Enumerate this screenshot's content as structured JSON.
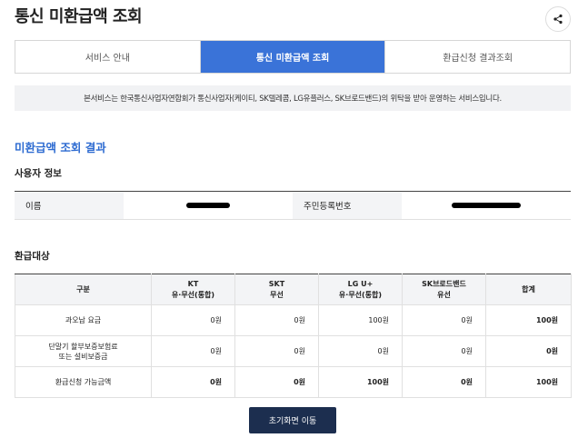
{
  "page": {
    "title": "통신 미환급액 조회",
    "share_icon": "share-icon"
  },
  "tabs": [
    {
      "label": "서비스 안내",
      "active": false
    },
    {
      "label": "통신 미환급액 조회",
      "active": true
    },
    {
      "label": "환급신청 결과조회",
      "active": false
    }
  ],
  "notice": "본서비스는 한국통신사업자연합회가 통신사업자(케이티, SK텔레콤, LG유플러스, SK브로드밴드)의 위탁을 받아 운영하는 서비스입니다.",
  "result_title": "미환급액 조회 결과",
  "user_info": {
    "title": "사용자 정보",
    "name_label": "이름",
    "name_value": "",
    "id_label": "주민등록번호",
    "id_value": ""
  },
  "refund": {
    "title": "환급대상",
    "columns": [
      {
        "line1": "구분",
        "line2": ""
      },
      {
        "line1": "KT",
        "line2": "유·무선(통합)"
      },
      {
        "line1": "SKT",
        "line2": "무선"
      },
      {
        "line1": "LG U+",
        "line2": "유·무선(통합)"
      },
      {
        "line1": "SK브로드밴드",
        "line2": "유선"
      },
      {
        "line1": "합계",
        "line2": ""
      }
    ],
    "rows": [
      {
        "label1": "과오납 요금",
        "label2": "",
        "values": [
          "0원",
          "0원",
          "100원",
          "0원",
          "100원"
        ]
      },
      {
        "label1": "단말기 할부보증보험료",
        "label2": "또는 설비보증금",
        "values": [
          "0원",
          "0원",
          "0원",
          "0원",
          "0원"
        ]
      },
      {
        "label1": "환급신청 가능금액",
        "label2": "",
        "values": [
          "0원",
          "0원",
          "100원",
          "0원",
          "100원"
        ]
      }
    ]
  },
  "home_button": "초기화면 이동",
  "colors": {
    "accent": "#3a73d8",
    "title_blue": "#2d6bd1",
    "button_navy": "#1c2e4f"
  }
}
